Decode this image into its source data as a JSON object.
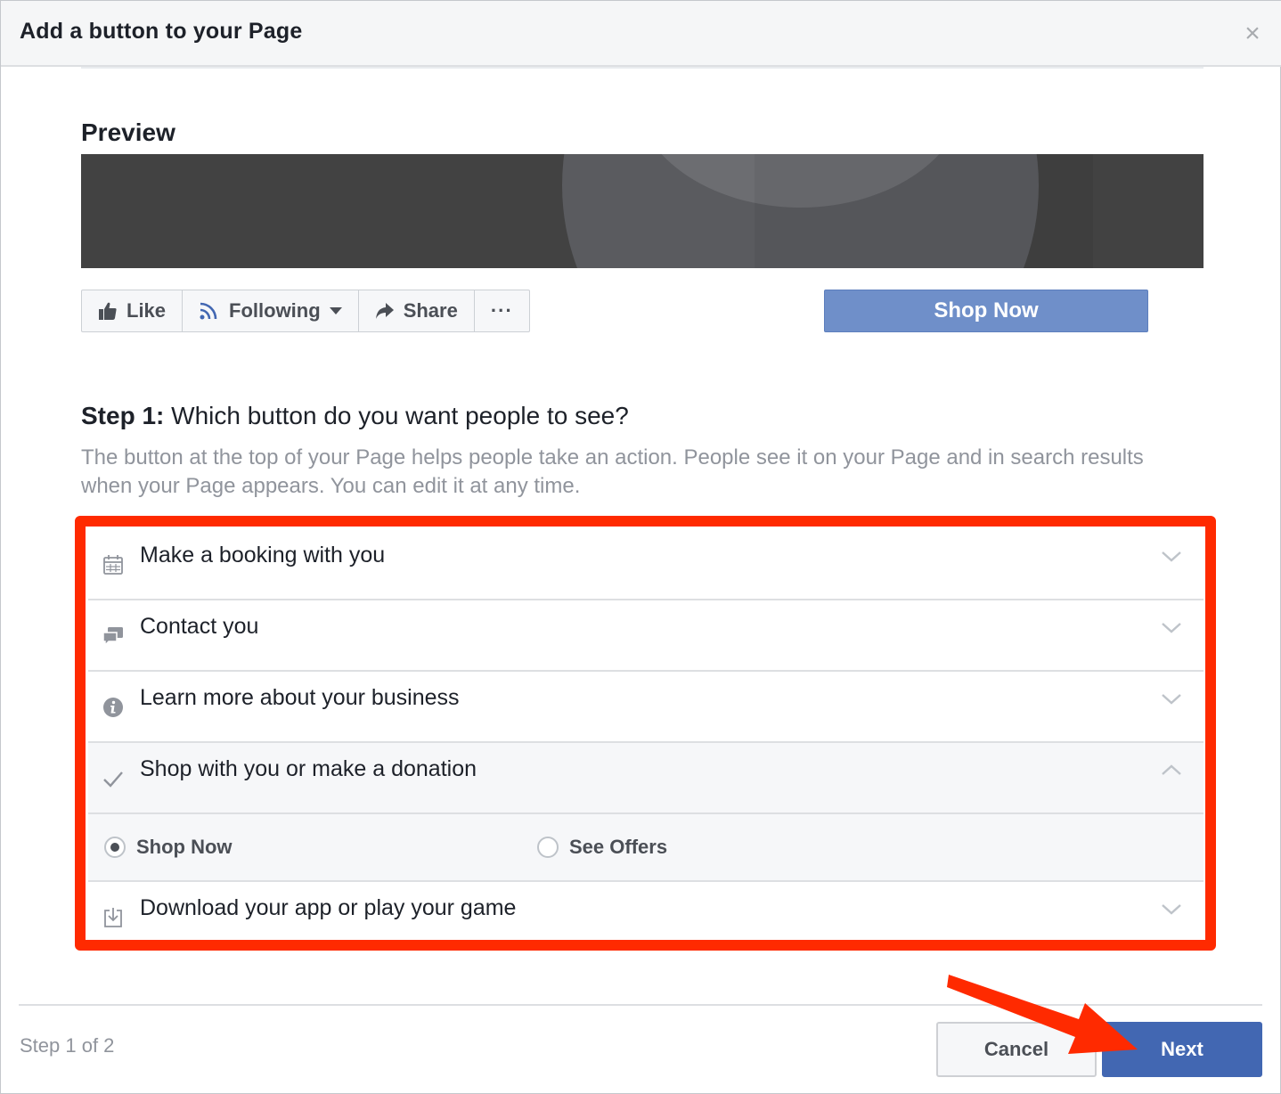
{
  "dialog": {
    "title": "Add a button to your Page",
    "close_glyph": "×"
  },
  "preview": {
    "title": "Preview",
    "actions": {
      "like": "Like",
      "following": "Following",
      "share": "Share",
      "more": "···"
    },
    "cta_button": "Shop Now"
  },
  "step": {
    "label_bold": "Step 1:",
    "label_rest": " Which button do you want people to see?",
    "description": "The button at the top of your Page helps people take an action. People see it on your Page and in search results when your Page appears. You can edit it at any time."
  },
  "options": [
    {
      "label": "Make a booking with you",
      "icon": "calendar-icon",
      "expanded": false
    },
    {
      "label": "Contact you",
      "icon": "chat-bubbles-icon",
      "expanded": false
    },
    {
      "label": "Learn more about your business",
      "icon": "info-icon",
      "expanded": false
    },
    {
      "label": "Shop with you or make a donation",
      "icon": "check-icon",
      "expanded": true
    },
    {
      "label": "Download your app or play your game",
      "icon": "download-icon",
      "expanded": false
    }
  ],
  "sub_options": {
    "shop_now": "Shop Now",
    "see_offers": "See Offers",
    "selected": "Shop Now"
  },
  "footer": {
    "step_count": "Step 1 of 2",
    "cancel": "Cancel",
    "next": "Next"
  },
  "colors": {
    "accent": "#4267b2",
    "cta": "#6f8fc9",
    "highlight": "#ff2a00"
  }
}
